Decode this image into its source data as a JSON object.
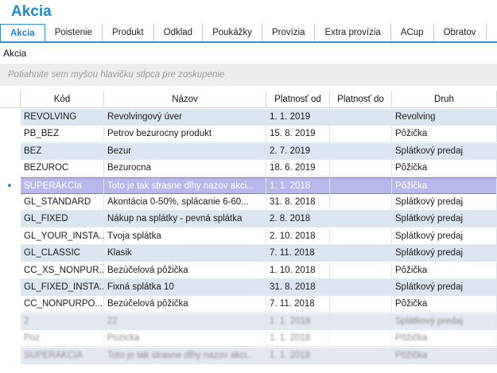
{
  "app": {
    "title": "Akcia"
  },
  "tabs": [
    {
      "label": "Akcia",
      "active": true
    },
    {
      "label": "Poistenie"
    },
    {
      "label": "Produkt"
    },
    {
      "label": "Odklad"
    },
    {
      "label": "Poukážky"
    },
    {
      "label": "Provízia"
    },
    {
      "label": "Extra provízia"
    },
    {
      "label": "ACup"
    },
    {
      "label": "Obratov"
    }
  ],
  "section_label": "Akcia",
  "group_panel": {
    "hint": "Potiahnite sem myšou hlavičku stĺpca pre zoskupenie"
  },
  "columns": [
    "Kód",
    "Názov",
    "Platnosť od",
    "Platnosť do",
    "Druh"
  ],
  "rows": [
    [
      "REVOLVING",
      "Revolvingový úver",
      "1. 1. 2019",
      "",
      "Revolving"
    ],
    [
      "PB_BEZ",
      "Petrov bezurocny produkt",
      "15. 8. 2019",
      "",
      "Pôžička"
    ],
    [
      "BEZ",
      "Bezur",
      "2. 7. 2019",
      "",
      "Splátkový predaj"
    ],
    [
      "BEZUROC",
      "Bezurocna",
      "18. 6. 2019",
      "",
      "Pôžička"
    ],
    [
      "SUPERAKCIa",
      "Toto je tak strasne dlhy nazov akci...",
      "1. 1. 2018",
      "",
      "Pôžička"
    ],
    [
      "GL_STANDARD",
      "Akontácia 0-50%, splácanie 6-60...",
      "31. 8. 2018",
      "",
      "Splátkový predaj"
    ],
    [
      "GL_FIXED",
      "Nákup na splátky - pevná splátka",
      "2. 8. 2018",
      "",
      "Splátkový predaj"
    ],
    [
      "GL_YOUR_INSTA...",
      "Tvoja splátka",
      "2. 10. 2018",
      "",
      "Splátkový predaj"
    ],
    [
      "GL_CLASSIC",
      "Klasik",
      "7. 11. 2018",
      "",
      "Splátkový predaj"
    ],
    [
      "CC_XS_NONPUR...",
      "Bezúčelová pôžička",
      "1. 10. 2018",
      "",
      "Pôžička"
    ],
    [
      "GL_FIXED_INSTA...",
      "Fixná splátka 10",
      "31. 8. 2018",
      "",
      "Splátkový predaj"
    ],
    [
      "CC_NONPURPO...",
      "Bezúčelová pôžička",
      "7. 11. 2018",
      "",
      "Pôžička"
    ],
    [
      "2",
      "22",
      "1. 1. 2018",
      "",
      "Splátkový predaj"
    ],
    [
      "Poz",
      "Pozicka",
      "1. 1. 2018",
      "",
      "Pôžička"
    ],
    [
      "SUPERAKCIA",
      "Toto je tak strasne dlhy nazov akci...",
      "1. 1. 2018",
      "",
      "Pôžička"
    ]
  ],
  "selected_row": 4,
  "blurred_from_row": 12,
  "colors": {
    "accent": "#1e88d6",
    "selected_row": "#b9b8ec",
    "alt_row": "#dce6f1"
  }
}
